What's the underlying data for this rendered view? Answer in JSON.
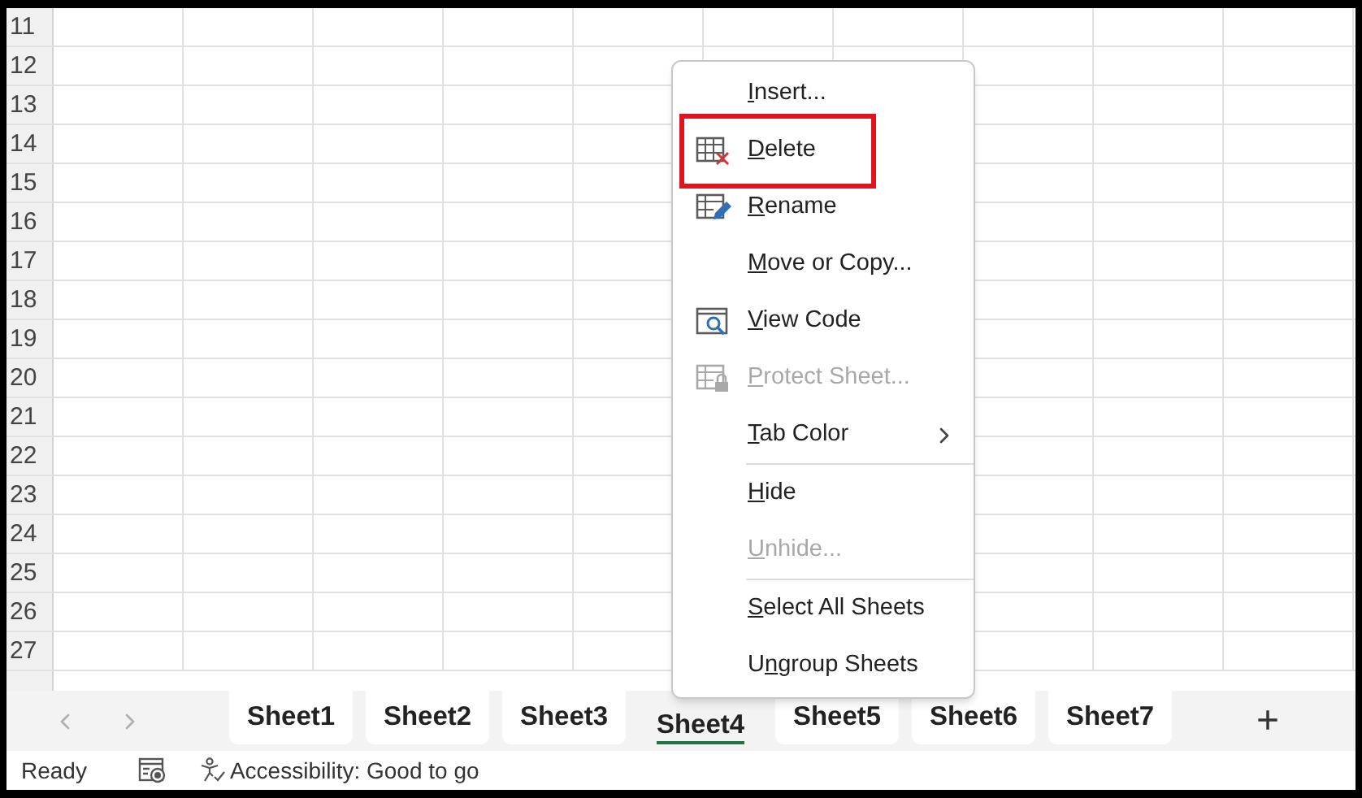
{
  "grid": {
    "row_numbers": [
      "11",
      "12",
      "13",
      "14",
      "15",
      "16",
      "17",
      "18",
      "19",
      "20",
      "21",
      "22",
      "23",
      "24",
      "25",
      "26",
      "27"
    ]
  },
  "context_menu": {
    "groups": [
      [
        {
          "access_key": "I",
          "label_after": "nsert...",
          "disabled": false,
          "submenu": false,
          "highlighted": false
        },
        {
          "access_key": "D",
          "label_after": "elete",
          "disabled": false,
          "submenu": false,
          "highlighted": true
        },
        {
          "access_key": "R",
          "label_after": "ename",
          "disabled": false,
          "submenu": false,
          "highlighted": false
        },
        {
          "access_key": "M",
          "label_after": "ove or Copy...",
          "disabled": false,
          "submenu": false,
          "highlighted": false
        },
        {
          "access_key": "V",
          "label_after": "iew Code",
          "disabled": false,
          "submenu": false,
          "highlighted": false
        },
        {
          "access_key": "P",
          "label_after": "rotect Sheet...",
          "disabled": true,
          "submenu": false,
          "highlighted": false
        },
        {
          "access_key": "T",
          "label_after": "ab Color",
          "disabled": false,
          "submenu": true,
          "highlighted": false
        }
      ],
      [
        {
          "access_key": "H",
          "label_after": "ide",
          "disabled": false,
          "submenu": false,
          "highlighted": false
        },
        {
          "access_key": "U",
          "label_after": "nhide...",
          "disabled": true,
          "submenu": false,
          "highlighted": false
        }
      ],
      [
        {
          "access_key": "S",
          "label_after": "elect All Sheets",
          "disabled": false,
          "submenu": false,
          "highlighted": false
        },
        {
          "label_before": "U",
          "access_key": "n",
          "label_after": "group Sheets",
          "disabled": false,
          "submenu": false,
          "highlighted": false
        }
      ]
    ]
  },
  "sheet_tabs": [
    {
      "label": "Sheet1",
      "selected": false
    },
    {
      "label": "Sheet2",
      "selected": false
    },
    {
      "label": "Sheet3",
      "selected": false
    },
    {
      "label": "Sheet4",
      "selected": true
    },
    {
      "label": "Sheet5",
      "selected": false
    },
    {
      "label": "Sheet6",
      "selected": false
    },
    {
      "label": "Sheet7",
      "selected": false
    }
  ],
  "add_sheet": "+",
  "status_bar": {
    "status": "Ready",
    "accessibility": "Accessibility: Good to go"
  }
}
